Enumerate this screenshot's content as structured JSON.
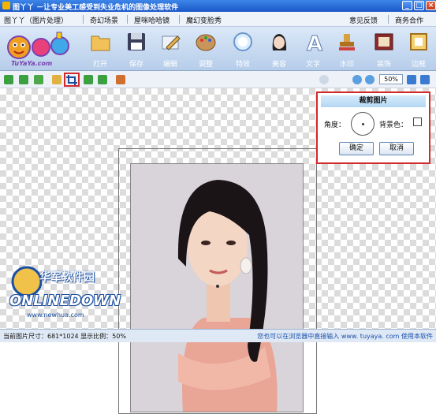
{
  "window": {
    "title": "图丫丫  －让专业美工感受到失业危机的图像处理软件"
  },
  "menubar": {
    "items": [
      {
        "label": "图丫丫（图片处理）"
      },
      {
        "label": "奇幻场景"
      },
      {
        "label": "屋咪哈哈镜"
      },
      {
        "label": "魔幻变脸秀"
      }
    ],
    "right_items": [
      {
        "label": "意见反馈"
      },
      {
        "label": "商务合作"
      }
    ]
  },
  "toolbar": {
    "logo_text": "TuYaYa.com",
    "tools": [
      {
        "label": "打开",
        "icon": "folder-icon"
      },
      {
        "label": "保存",
        "icon": "floppy-icon"
      },
      {
        "label": "编辑",
        "icon": "pencil-icon"
      },
      {
        "label": "调整",
        "icon": "palette-icon"
      },
      {
        "label": "特效",
        "icon": "circle-icon"
      },
      {
        "label": "美容",
        "icon": "face-icon"
      },
      {
        "label": "文字",
        "icon": "letter-a-icon"
      },
      {
        "label": "水印",
        "icon": "stamp-icon"
      },
      {
        "label": "装饰",
        "icon": "frame-icon"
      },
      {
        "label": "边框",
        "icon": "border-icon"
      }
    ]
  },
  "subbar": {
    "zoom_value": "50%"
  },
  "crop_panel": {
    "title": "裁剪图片",
    "angle_label": "角度：",
    "bg_color_label": "背景色：",
    "ok_label": "确定",
    "cancel_label": "取消"
  },
  "statusbar": {
    "left_text": "当前图片尺寸：681*1024    显示比例：50%",
    "right_text": "您也可以在浏览器中直接输入  www. tuyaya. com  使用本软件"
  },
  "watermark": {
    "cn": "华军软件园",
    "en": "ONLINEDOWN",
    "url": "www.newhua.com"
  },
  "colors": {
    "title_bar": "#1a57c8",
    "highlight": "#d12a2a",
    "statusbar_text": "#1a4fa8"
  }
}
